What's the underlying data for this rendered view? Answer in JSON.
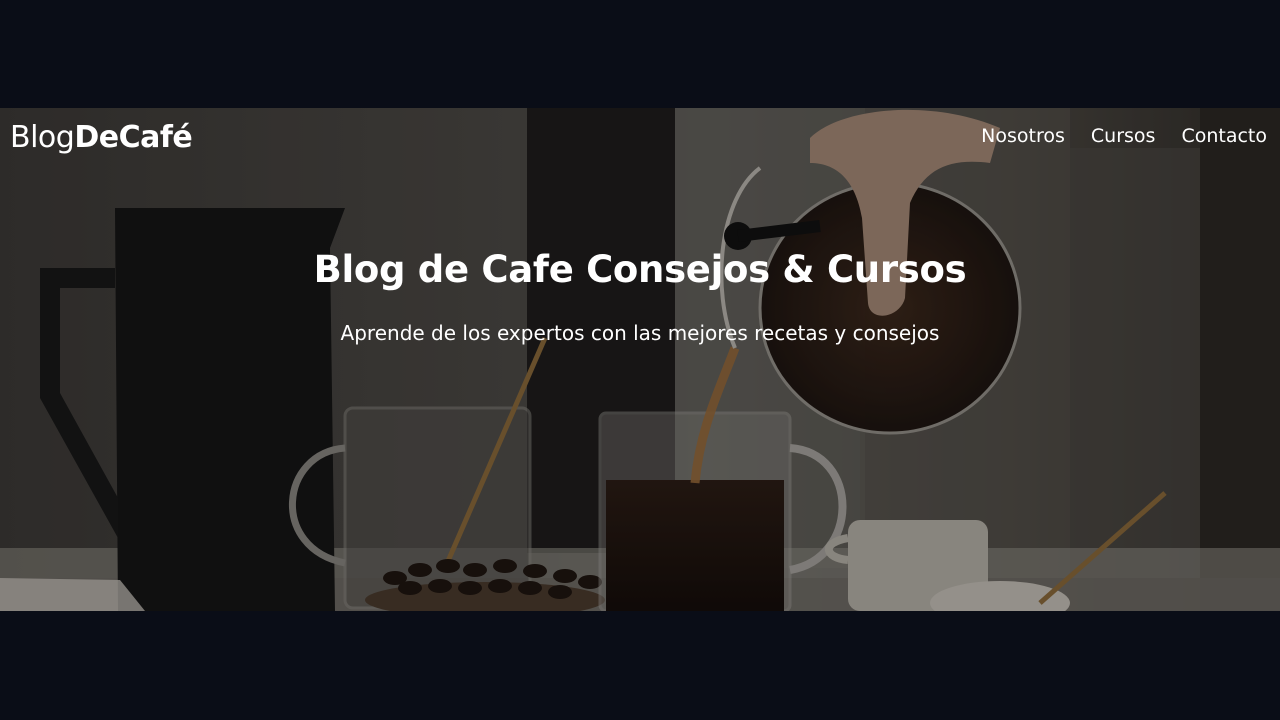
{
  "header": {
    "logo_light": "Blog",
    "logo_bold": "DeCafé",
    "nav": [
      {
        "label": "Nosotros"
      },
      {
        "label": "Cursos"
      },
      {
        "label": "Contacto"
      }
    ]
  },
  "hero": {
    "title": "Blog de Cafe Consejos & Cursos",
    "subtitle": "Aprende de los expertos con las mejores recetas y consejos",
    "background_image": "coffee-pouring-photo",
    "overlay_color": "#0a0a0c"
  },
  "colors": {
    "page_background": "#0a0d17",
    "text": "#ffffff"
  }
}
